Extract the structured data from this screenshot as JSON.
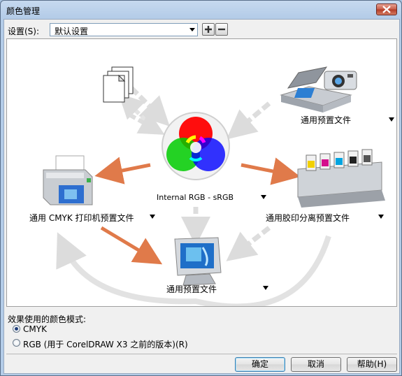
{
  "window": {
    "title": "颜色管理"
  },
  "settings": {
    "label": "设置(S):",
    "selected": "默认设置",
    "add_label": "+",
    "remove_label": "−"
  },
  "diagram": {
    "scanner_profile": "通用预置文件",
    "internal_rgb": "Internal RGB - sRGB",
    "printer_profile": "通用 CMYK 打印机预置文件",
    "press_profile": "通用胶印分离预置文件",
    "monitor_profile": "通用预置文件"
  },
  "mode": {
    "label": "效果使用的颜色模式:",
    "options": [
      {
        "label": "CMYK",
        "checked": true
      },
      {
        "label": "RGB (用于 CorelDRAW X3 之前的版本)(R)",
        "checked": false
      }
    ]
  },
  "buttons": {
    "ok": "确定",
    "cancel": "取消",
    "help": "帮助(H)"
  },
  "colors": {
    "flow_arrow": "#e07a4a",
    "grey_arrow": "#dddddd",
    "client_bg": "#f0f0f0"
  }
}
